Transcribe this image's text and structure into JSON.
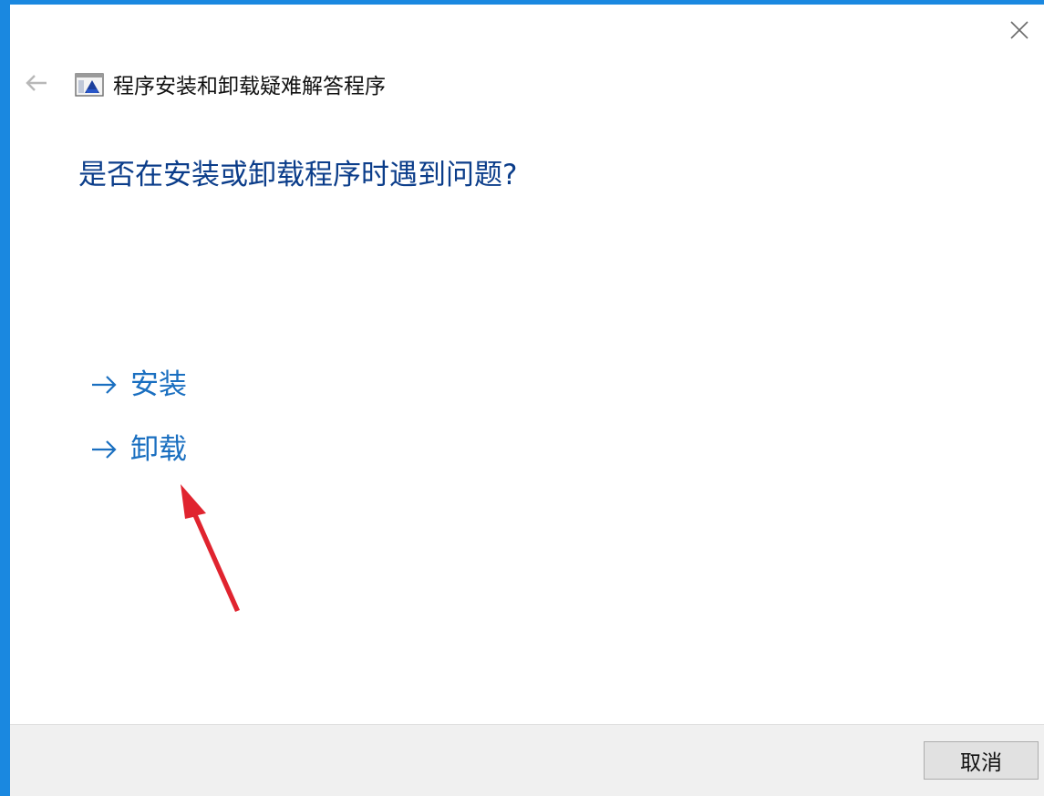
{
  "window": {
    "title": "程序安装和卸载疑难解答程序",
    "accent_color": "#1a88e0"
  },
  "header": {
    "back_icon": "back-arrow-icon",
    "close_icon": "close-icon",
    "app_icon": "troubleshooter-icon"
  },
  "main": {
    "question": "是否在安装或卸载程序时遇到问题?",
    "options": [
      {
        "label": "安装",
        "icon": "arrow-right-icon"
      },
      {
        "label": "卸载",
        "icon": "arrow-right-icon"
      }
    ],
    "link_color": "#1a6fc0",
    "heading_color": "#0b3d8a",
    "annotation": {
      "icon": "red-pointer-arrow",
      "color": "#e0242f"
    }
  },
  "footer": {
    "cancel_label": "取消"
  }
}
